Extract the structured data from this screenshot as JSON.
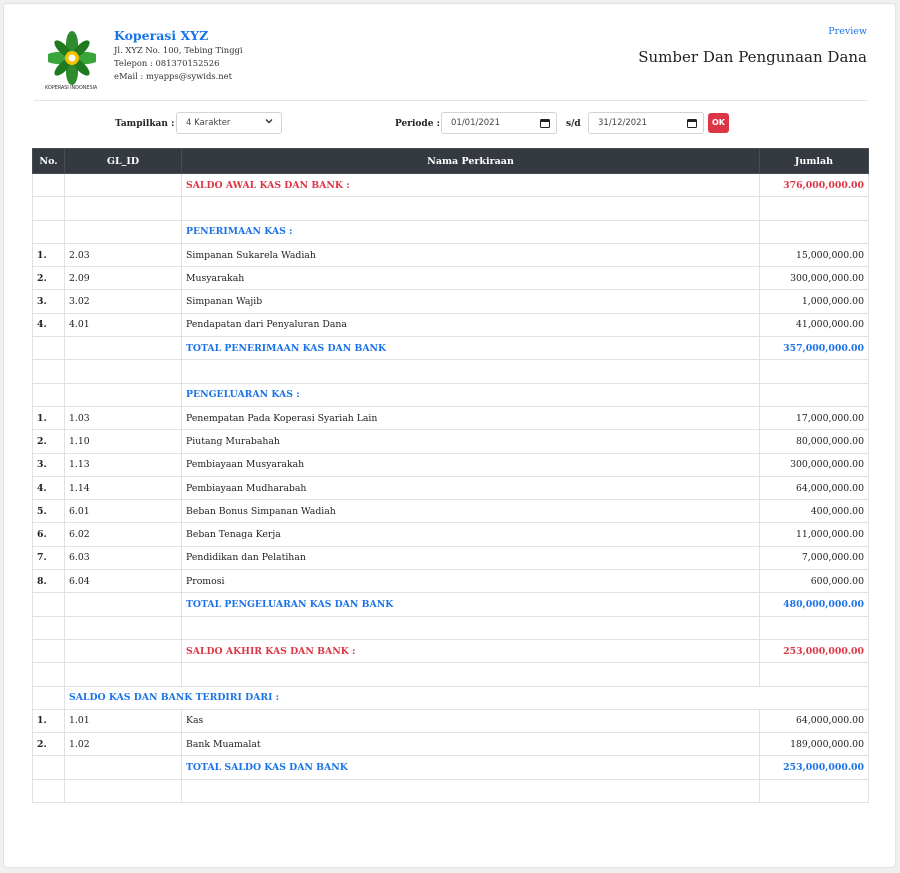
{
  "company": {
    "name": "Koperasi XYZ",
    "address": "Jl. XYZ No. 100, Tebing Tinggi",
    "phone": "Telepon : 081370152526",
    "email": "eMail : myapps@sywids.net",
    "logo_caption": "KOPERASI INDONESIA"
  },
  "header": {
    "preview_label": "Preview",
    "title": "Sumber Dan Pengunaan Dana"
  },
  "filters": {
    "tampilkan_label": "Tampilkan :",
    "tampilkan_value": "4 Karakter",
    "periode_label": "Periode :",
    "date_from": "01/01/2021",
    "sd_label": "s/d",
    "date_to": "31/12/2021",
    "ok_label": "OK"
  },
  "colors": {
    "accent": "#1a73e8",
    "danger": "#dc3545",
    "table_header": "#343a40"
  },
  "table": {
    "headers": {
      "no": "No.",
      "gl": "GL_ID",
      "name": "Nama Perkiraan",
      "amount": "Jumlah"
    },
    "rows": [
      {
        "no": "",
        "gl": "",
        "name": "SALDO AWAL KAS DAN BANK :",
        "amount": "376,000,000.00",
        "style": "red"
      },
      {
        "no": "",
        "gl": "",
        "name": "",
        "amount": "",
        "style": ""
      },
      {
        "no": "",
        "gl": "",
        "name": "PENERIMAAN KAS :",
        "amount": "",
        "style": "blue"
      },
      {
        "no": "1.",
        "gl": "2.03",
        "name": "Simpanan Sukarela Wadiah",
        "amount": "15,000,000.00",
        "style": ""
      },
      {
        "no": "2.",
        "gl": "2.09",
        "name": "Musyarakah",
        "amount": "300,000,000.00",
        "style": ""
      },
      {
        "no": "3.",
        "gl": "3.02",
        "name": "Simpanan Wajib",
        "amount": "1,000,000.00",
        "style": ""
      },
      {
        "no": "4.",
        "gl": "4.01",
        "name": "Pendapatan dari Penyaluran Dana",
        "amount": "41,000,000.00",
        "style": ""
      },
      {
        "no": "",
        "gl": "",
        "name": "TOTAL PENERIMAAN KAS DAN BANK",
        "amount": "357,000,000.00",
        "style": "blue"
      },
      {
        "no": "",
        "gl": "",
        "name": "",
        "amount": "",
        "style": ""
      },
      {
        "no": "",
        "gl": "",
        "name": "PENGELUARAN KAS :",
        "amount": "",
        "style": "blue"
      },
      {
        "no": "1.",
        "gl": "1.03",
        "name": "Penempatan Pada Koperasi Syariah Lain",
        "amount": "17,000,000.00",
        "style": ""
      },
      {
        "no": "2.",
        "gl": "1.10",
        "name": "Piutang Murabahah",
        "amount": "80,000,000.00",
        "style": ""
      },
      {
        "no": "3.",
        "gl": "1.13",
        "name": "Pembiayaan Musyarakah",
        "amount": "300,000,000.00",
        "style": ""
      },
      {
        "no": "4.",
        "gl": "1.14",
        "name": "Pembiayaan Mudharabah",
        "amount": "64,000,000.00",
        "style": ""
      },
      {
        "no": "5.",
        "gl": "6.01",
        "name": "Beban Bonus Simpanan Wadiah",
        "amount": "400,000.00",
        "style": ""
      },
      {
        "no": "6.",
        "gl": "6.02",
        "name": "Beban Tenaga Kerja",
        "amount": "11,000,000.00",
        "style": ""
      },
      {
        "no": "7.",
        "gl": "6.03",
        "name": "Pendidikan dan Pelatihan",
        "amount": "7,000,000.00",
        "style": ""
      },
      {
        "no": "8.",
        "gl": "6.04",
        "name": "Promosi",
        "amount": "600,000.00",
        "style": ""
      },
      {
        "no": "",
        "gl": "",
        "name": "TOTAL PENGELUARAN KAS DAN BANK",
        "amount": "480,000,000.00",
        "style": "blue"
      },
      {
        "no": "",
        "gl": "",
        "name": "",
        "amount": "",
        "style": ""
      },
      {
        "no": "",
        "gl": "",
        "name": "SALDO AKHIR KAS DAN BANK :",
        "amount": "253,000,000.00",
        "style": "red"
      },
      {
        "no": "",
        "gl": "",
        "name": "",
        "amount": "",
        "style": ""
      },
      {
        "no": "",
        "gl": "SALDO KAS DAN BANK TERDIRI DARI :",
        "name": "",
        "amount": "",
        "style": "span-blue"
      },
      {
        "no": "1.",
        "gl": "1.01",
        "name": "Kas",
        "amount": "64,000,000.00",
        "style": ""
      },
      {
        "no": "2.",
        "gl": "1.02",
        "name": "Bank Muamalat",
        "amount": "189,000,000.00",
        "style": ""
      },
      {
        "no": "",
        "gl": "",
        "name": "TOTAL SALDO KAS DAN BANK",
        "amount": "253,000,000.00",
        "style": "blue"
      },
      {
        "no": "",
        "gl": "",
        "name": "",
        "amount": "",
        "style": ""
      }
    ]
  }
}
